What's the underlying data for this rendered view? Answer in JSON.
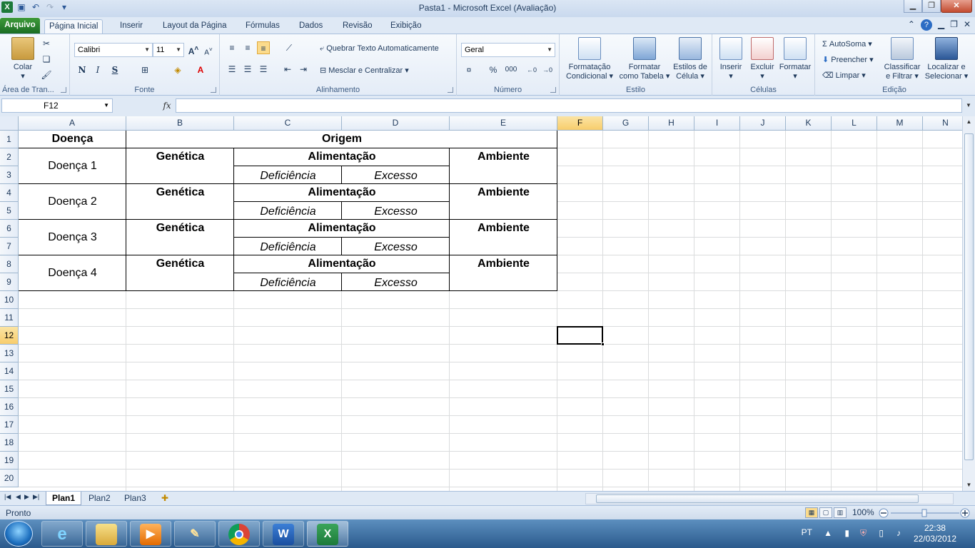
{
  "window": {
    "title": "Pasta1  -  Microsoft Excel (Avaliação)",
    "app_icon": "excel-icon",
    "quick_access": [
      "save-icon",
      "undo-icon",
      "redo-icon",
      "customize-icon"
    ],
    "controls": [
      "minimize-icon",
      "restore-icon",
      "close-icon"
    ]
  },
  "tabs": {
    "file": "Arquivo",
    "items": [
      "Página Inicial",
      "Inserir",
      "Layout da Página",
      "Fórmulas",
      "Dados",
      "Revisão",
      "Exibição"
    ],
    "active": "Página Inicial"
  },
  "ribbon": {
    "clipboard": {
      "label": "Área de Tran...",
      "paste": "Colar"
    },
    "font": {
      "label": "Fonte",
      "family": "Calibri",
      "size": "11",
      "bold": "N",
      "italic": "I",
      "underline": "S"
    },
    "alignment": {
      "label": "Alinhamento",
      "wrap": "Quebrar Texto Automaticamente",
      "merge": "Mesclar e Centralizar"
    },
    "number": {
      "label": "Número",
      "format": "Geral",
      "percent": "%",
      "thousands": "000"
    },
    "styles": {
      "label": "Estilo",
      "conditional": [
        "Formatação",
        "Condicional"
      ],
      "table": [
        "Formatar",
        "como Tabela"
      ],
      "cell": [
        "Estilos de",
        "Célula"
      ]
    },
    "cells": {
      "label": "Células",
      "insert": "Inserir",
      "delete": "Excluir",
      "format": "Formatar"
    },
    "editing": {
      "label": "Edição",
      "autosum": "AutoSoma",
      "fill": "Preencher",
      "clear": "Limpar",
      "sort": [
        "Classificar",
        "e Filtrar"
      ],
      "find": [
        "Localizar e",
        "Selecionar"
      ]
    }
  },
  "formula_bar": {
    "name_box": "F12",
    "fx": "fx",
    "content": ""
  },
  "columns": [
    "A",
    "B",
    "C",
    "D",
    "E",
    "F",
    "G",
    "H",
    "I",
    "J",
    "K",
    "L",
    "M",
    "N"
  ],
  "rows": [
    "1",
    "2",
    "3",
    "4",
    "5",
    "6",
    "7",
    "8",
    "9",
    "10",
    "11",
    "12",
    "13",
    "14",
    "15",
    "16",
    "17",
    "18",
    "19",
    "20"
  ],
  "selected_cell": {
    "col": "F",
    "row": "12"
  },
  "cells": {
    "A1": "Doença",
    "B1": "Origem",
    "A2": "Doença 1",
    "B2": "Genética",
    "C2": "Alimentação",
    "E2": "Ambiente",
    "C3": "Deficiência",
    "D3": "Excesso",
    "A4": "Doença 2",
    "B4": "Genética",
    "C4": "Alimentação",
    "E4": "Ambiente",
    "C5": "Deficiência",
    "D5": "Excesso",
    "A6": "Doença 3",
    "B6": "Genética",
    "C6": "Alimentação",
    "E6": "Ambiente",
    "C7": "Deficiência",
    "D7": "Excesso",
    "A8": "Doença 4",
    "B8": "Genética",
    "C8": "Alimentação",
    "E8": "Ambiente",
    "C9": "Deficiência",
    "D9": "Excesso"
  },
  "sheets": [
    "Plan1",
    "Plan2",
    "Plan3"
  ],
  "active_sheet": "Plan1",
  "status": {
    "text": "Pronto",
    "zoom": "100%"
  },
  "taskbar": {
    "apps": [
      "internet-explorer-icon",
      "explorer-icon",
      "media-player-icon",
      "tools-icon",
      "chrome-icon",
      "word-icon",
      "excel-icon"
    ],
    "lang": "PT",
    "time": "22:38",
    "date": "22/03/2012"
  },
  "colors": {
    "excel_green": "#1d7a3a",
    "selection_header": "#f8cd6c",
    "ribbon_bg": "#e4ecf7"
  }
}
